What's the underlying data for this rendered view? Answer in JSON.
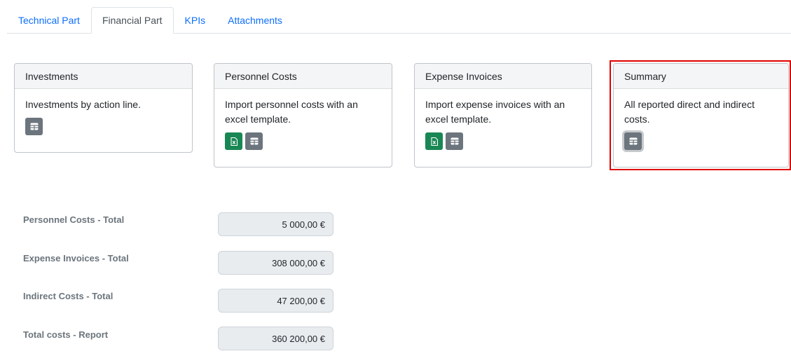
{
  "tabs": [
    {
      "label": "Technical Part",
      "active": false
    },
    {
      "label": "Financial Part",
      "active": true
    },
    {
      "label": "KPIs",
      "active": false
    },
    {
      "label": "Attachments",
      "active": false
    }
  ],
  "cards": {
    "investments": {
      "title": "Investments",
      "text": "Investments by action line.",
      "buttons": [
        "table-icon"
      ]
    },
    "personnel": {
      "title": "Personnel Costs",
      "text": "Import personnel costs with an excel template.",
      "buttons": [
        "excel-icon",
        "table-icon"
      ]
    },
    "expense": {
      "title": "Expense Invoices",
      "text": "Import expense invoices with an excel template.",
      "buttons": [
        "excel-icon",
        "table-icon"
      ]
    },
    "summary": {
      "title": "Summary",
      "text": "All reported direct and indirect costs.",
      "buttons": [
        "table-icon"
      ],
      "highlighted": true
    }
  },
  "totals": [
    {
      "label": "Personnel Costs - Total",
      "value": "5 000,00 €"
    },
    {
      "label": "Expense Invoices - Total",
      "value": "308 000,00 €"
    },
    {
      "label": "Indirect Costs - Total",
      "value": "47 200,00 €"
    },
    {
      "label": "Total costs - Report",
      "value": "360 200,00 €"
    }
  ],
  "colors": {
    "link": "#0d6efd",
    "button_gray": "#6c757d",
    "button_green": "#198754",
    "highlight": "#e00000"
  }
}
